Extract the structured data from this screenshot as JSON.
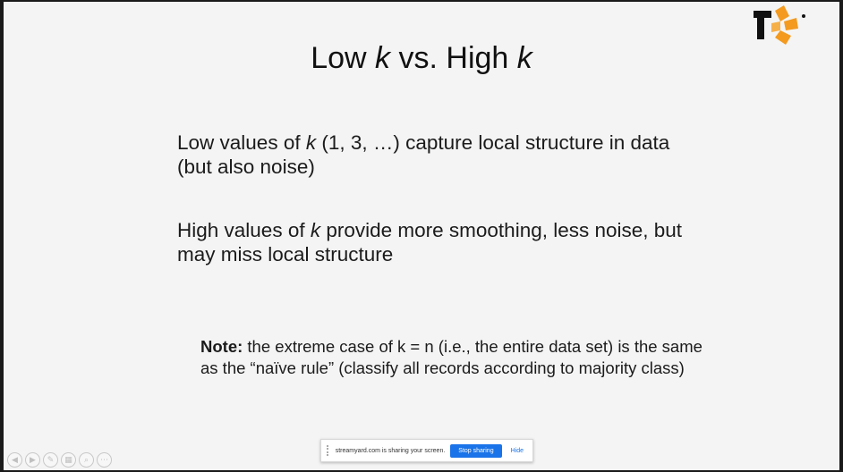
{
  "slide": {
    "title_pre": "Low ",
    "title_k1": "k",
    "title_mid": " vs. High ",
    "title_k2": "k",
    "bullet1": {
      "pre": "Low values of ",
      "k": "k",
      "post": " (1, 3, …) capture local structure in data (but also noise)"
    },
    "bullet2": {
      "pre": "High values of ",
      "k": "k",
      "post": " provide more smoothing, less noise, but may miss local structure"
    },
    "note": {
      "label": "Note:",
      "text": "  the extreme case of k = n (i.e., the entire data set) is the same as the “naïve rule” (classify all records according to majority class)"
    }
  },
  "controls": [
    {
      "name": "prev-slide-icon",
      "glyph": "◀"
    },
    {
      "name": "next-slide-icon",
      "glyph": "▶"
    },
    {
      "name": "pen-icon",
      "glyph": "✎"
    },
    {
      "name": "slides-icon",
      "glyph": "▦"
    },
    {
      "name": "zoom-icon",
      "glyph": "⌕"
    },
    {
      "name": "more-icon",
      "glyph": "⋯"
    }
  ],
  "share_bar": {
    "message": "streamyard.com is sharing your screen.",
    "stop_label": "Stop sharing",
    "hide_label": "Hide"
  },
  "colors": {
    "logo_orange": "#f39a1f",
    "logo_black": "#111111",
    "stop_blue": "#1a73e8"
  }
}
